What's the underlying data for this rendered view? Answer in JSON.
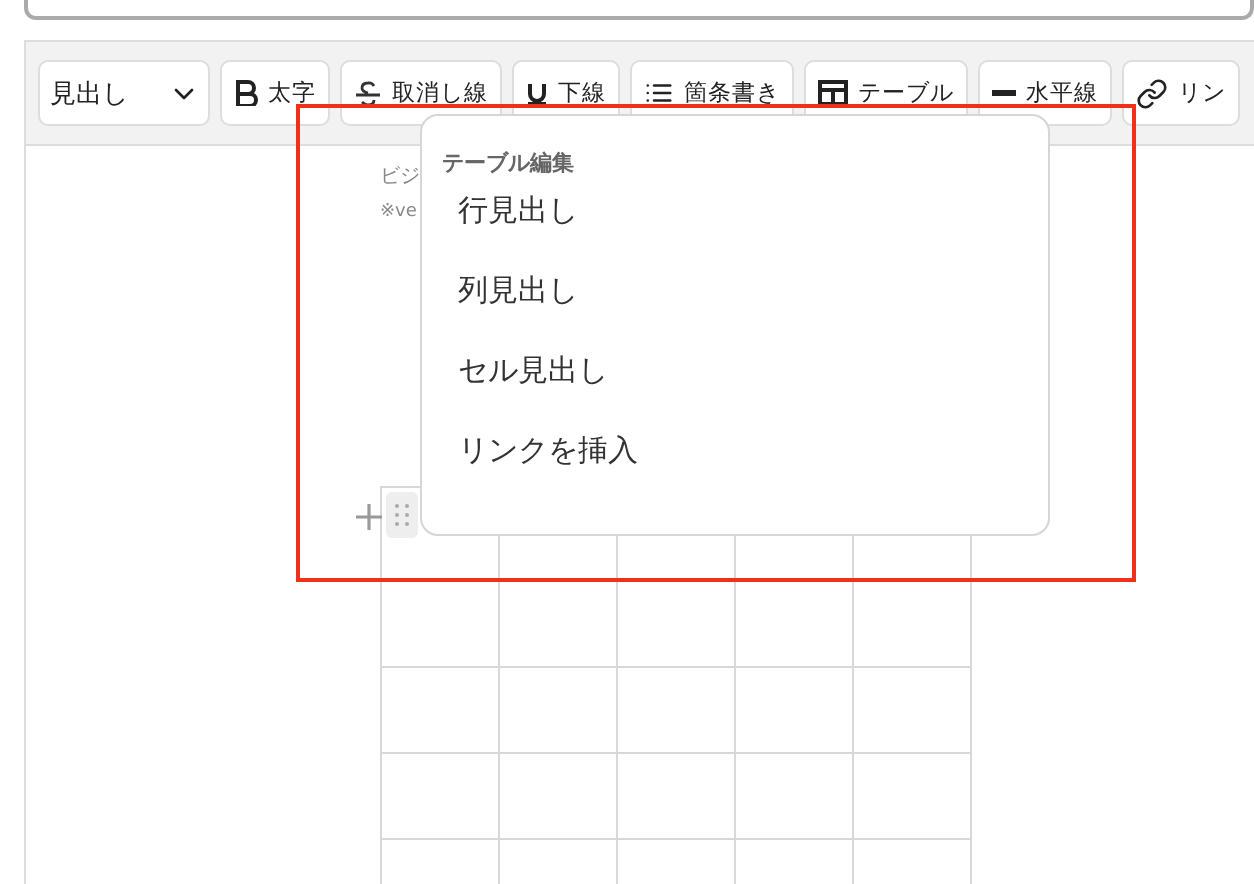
{
  "toolbar": {
    "heading_select": {
      "value": "見出し"
    },
    "buttons": [
      {
        "label": "太字"
      },
      {
        "label": "取消し線"
      },
      {
        "label": "下線"
      },
      {
        "label": "箇条書き"
      },
      {
        "label": "テーブル"
      },
      {
        "label": "水平線"
      },
      {
        "label": "リン"
      }
    ]
  },
  "editor": {
    "text_lines": [
      {
        "text": "ビジ",
        "kind": "body"
      },
      {
        "text": "※ve",
        "kind": "note"
      }
    ]
  },
  "context_menu": {
    "title": "テーブル編集",
    "items": [
      {
        "label": "行見出し"
      },
      {
        "label": "列見出し"
      },
      {
        "label": "セル見出し"
      },
      {
        "label": "リンクを挿入"
      }
    ]
  }
}
